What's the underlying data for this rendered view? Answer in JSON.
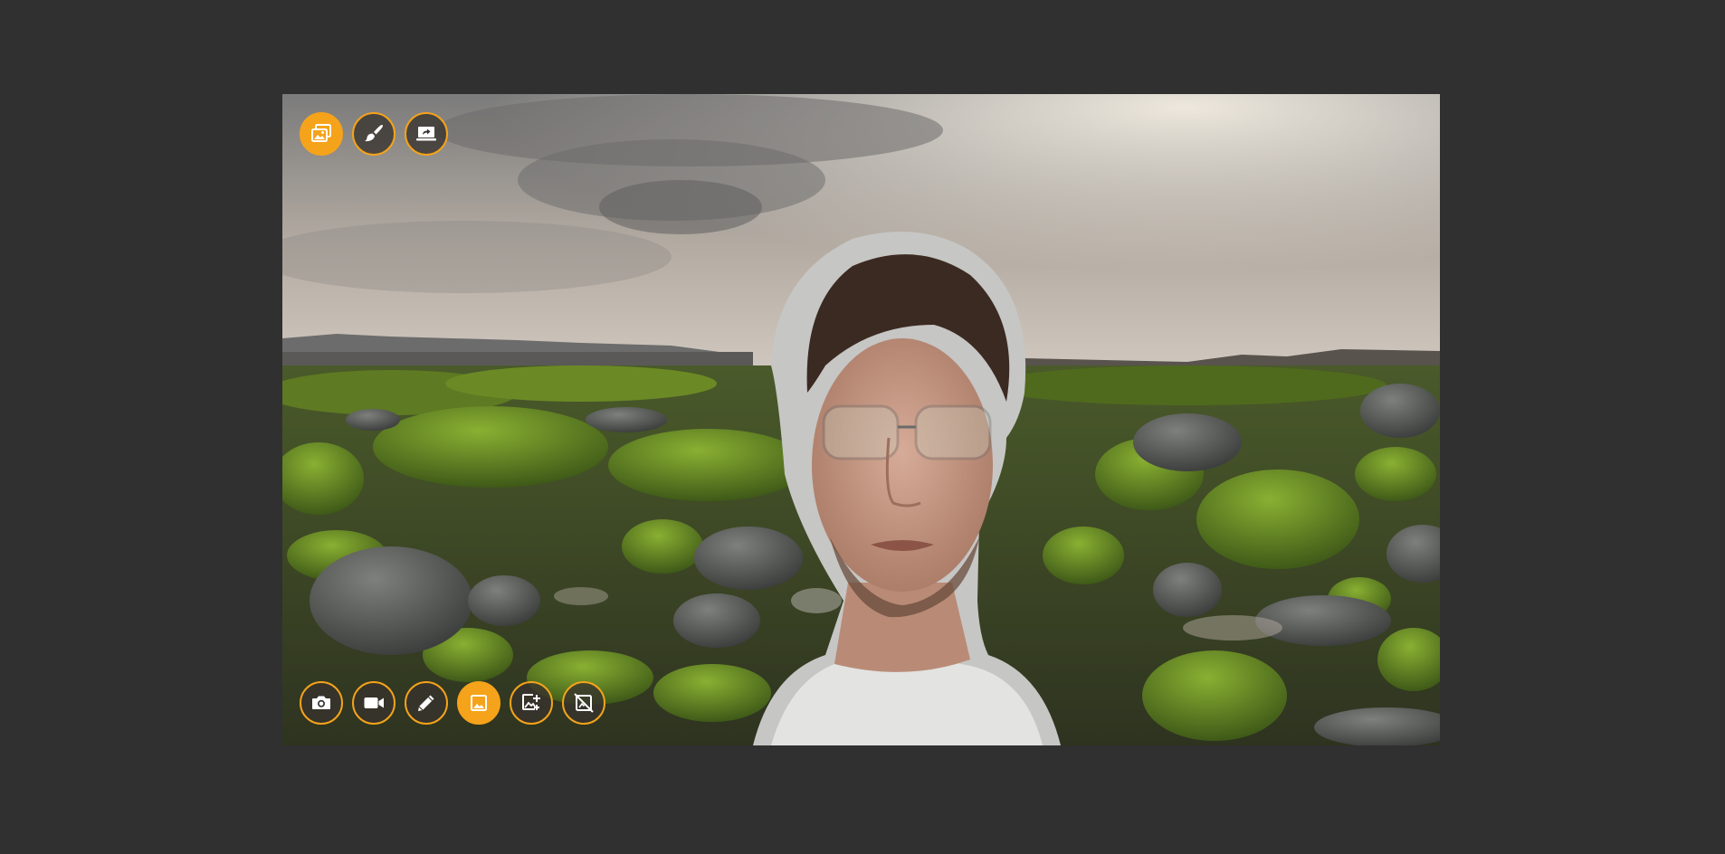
{
  "stage": {
    "background_scene": "mossy-rocky-shore-under-cloudy-sky",
    "subject": "person-with-glasses-webcam-cutout"
  },
  "colors": {
    "page_background": "#303030",
    "accent": "#f5a31a",
    "button_background": "#37322d",
    "icon": "#ffffff"
  },
  "top_toolbar": {
    "buttons": [
      {
        "icon": "images-icon",
        "active": true
      },
      {
        "icon": "paintbrush-icon",
        "active": false
      },
      {
        "icon": "share-screen-icon",
        "active": false
      }
    ]
  },
  "bottom_toolbar": {
    "buttons": [
      {
        "icon": "camera-icon",
        "active": false
      },
      {
        "icon": "video-camera-icon",
        "active": false
      },
      {
        "icon": "pencil-icon",
        "active": false
      },
      {
        "icon": "image-icon",
        "active": true
      },
      {
        "icon": "add-image-icon",
        "active": false
      },
      {
        "icon": "no-image-icon",
        "active": false
      }
    ]
  }
}
